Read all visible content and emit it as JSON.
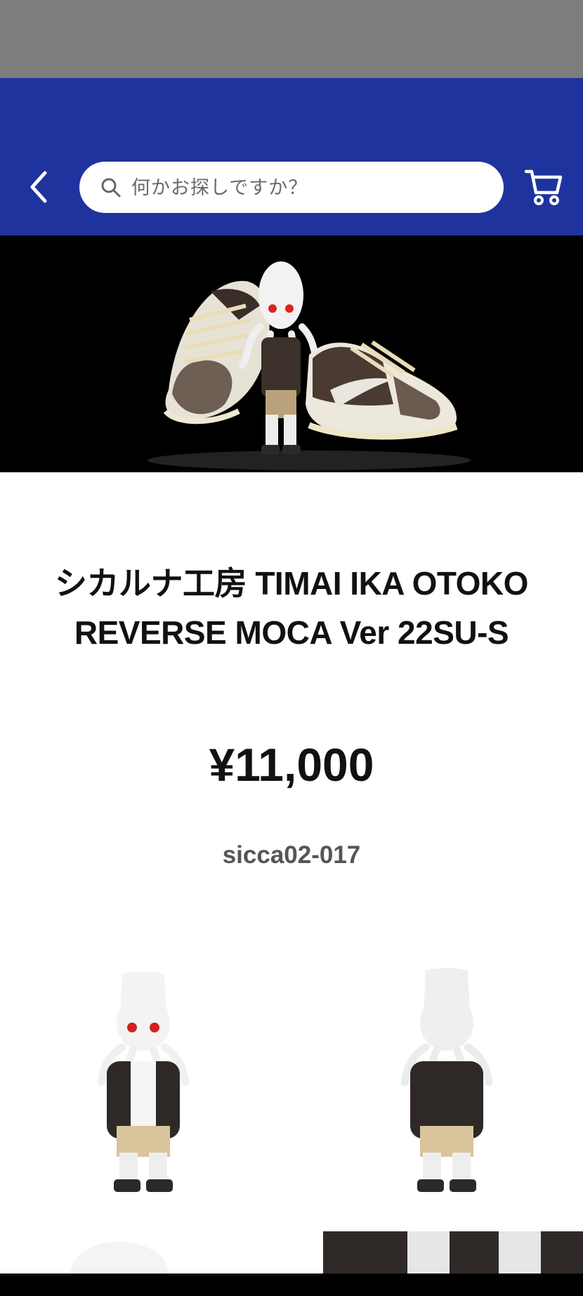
{
  "header": {
    "search_placeholder": "何かお探しですか？"
  },
  "icons": {
    "back": "chevron-left-icon",
    "search": "search-icon",
    "cart": "cart-icon"
  },
  "colors": {
    "status_bar": "#7d7d7d",
    "header_bg": "#1f339e",
    "hero_bg": "#000000"
  },
  "product": {
    "title_line1": "シカルナ工房 TIMAI IKA OTOKO",
    "title_line2": "REVERSE MOCA Ver 22SU-S",
    "price": "¥11,000",
    "sku": "sicca02-017"
  }
}
